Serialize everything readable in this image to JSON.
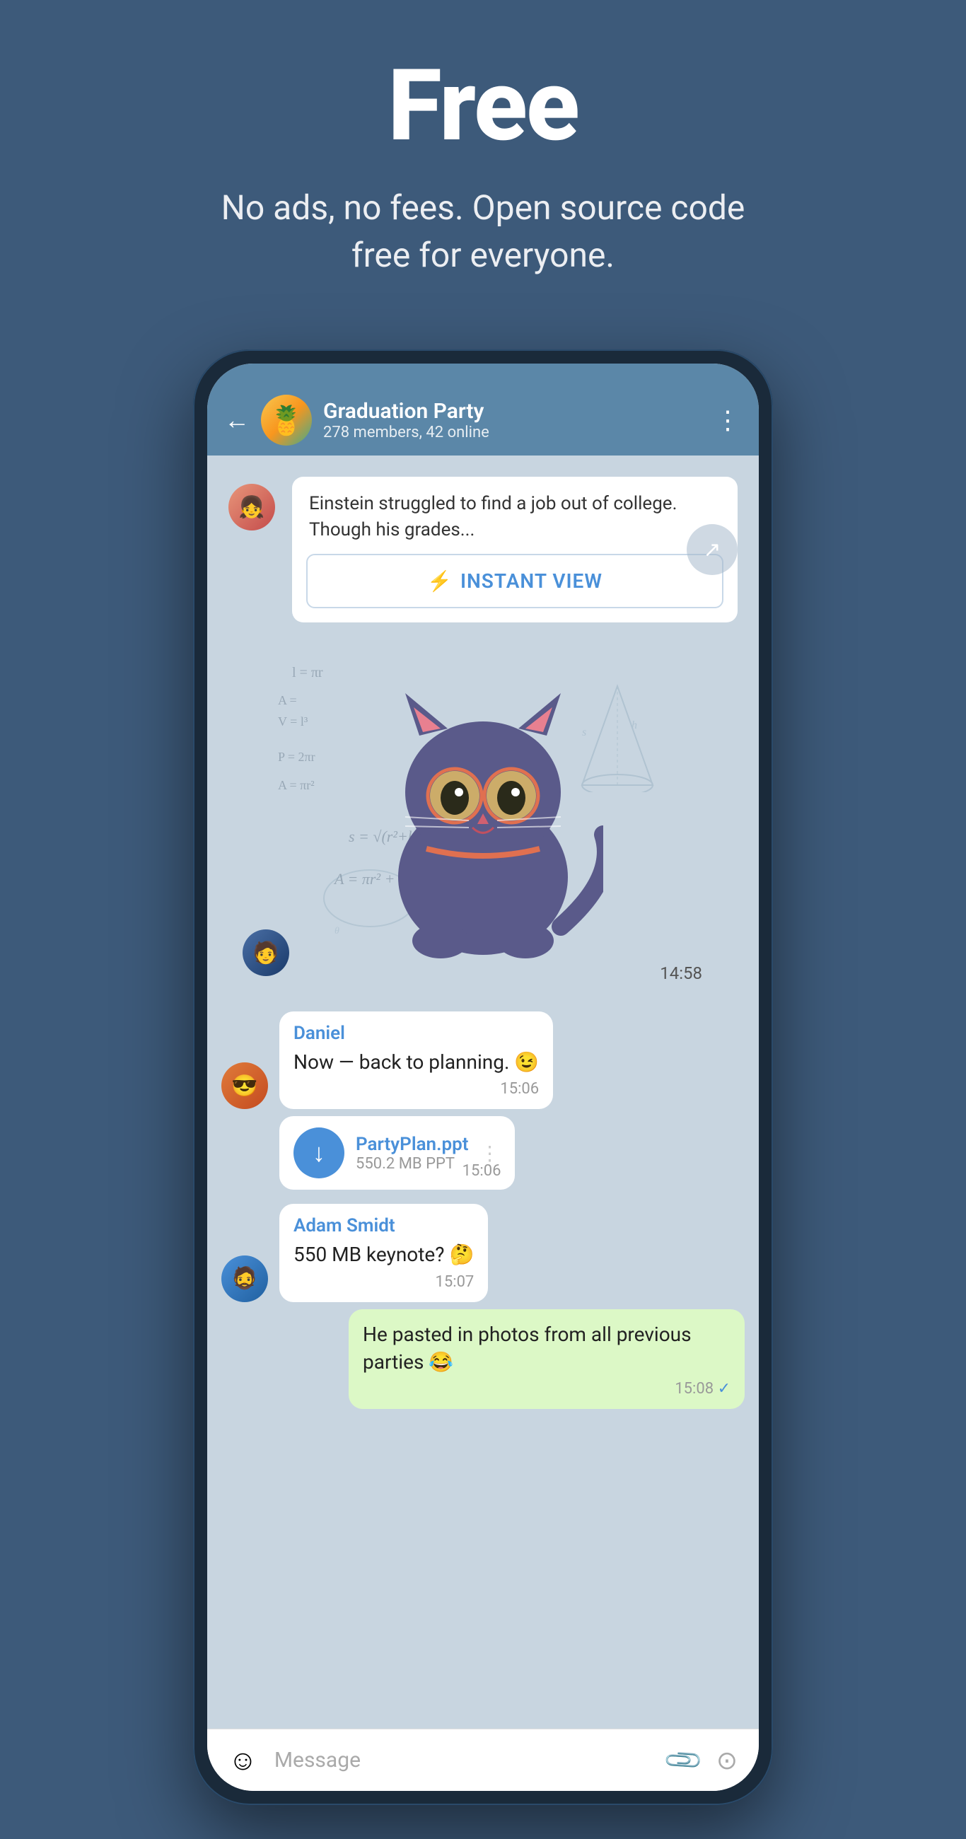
{
  "hero": {
    "title": "Free",
    "subtitle": "No ads, no fees. Open source code free for everyone."
  },
  "chat": {
    "back_label": "←",
    "group_name": "Graduation Party",
    "group_info": "278 members, 42 online",
    "more_icon": "⋮"
  },
  "messages": {
    "article_text": "Einstein struggled to find a job out of college. Though his grades...",
    "instant_view_label": "INSTANT VIEW",
    "sticker_time": "14:58",
    "daniel_name": "Daniel",
    "daniel_text": "Now — back to planning. 😉",
    "daniel_time": "15:06",
    "file_name": "PartyPlan.ppt",
    "file_size": "550.2 MB PPT",
    "file_time": "15:06",
    "adam_name": "Adam Smidt",
    "adam_text": "550 MB keynote? 🤔",
    "adam_time": "15:07",
    "own_text": "He pasted in photos from all previous parties 😂",
    "own_time": "15:08"
  },
  "input": {
    "placeholder": "Message"
  }
}
